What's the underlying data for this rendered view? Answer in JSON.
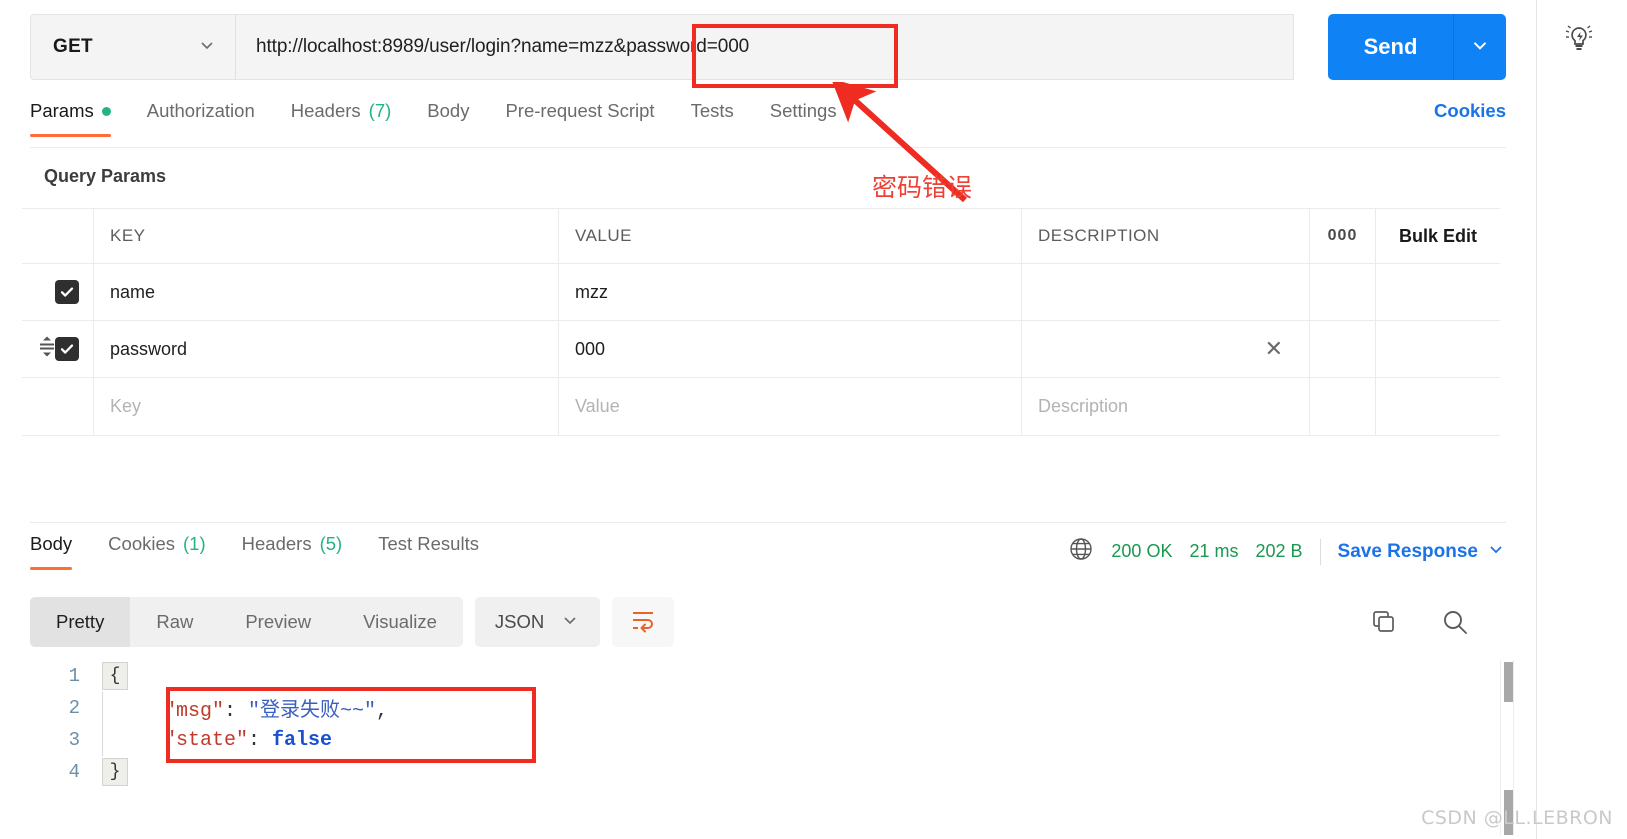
{
  "request": {
    "method": "GET",
    "url": "http://localhost:8989/user/login?name=mzz&password=000",
    "send_label": "Send",
    "tabs": [
      {
        "label": "Params",
        "badge": "",
        "dot": true,
        "active": true
      },
      {
        "label": "Authorization",
        "badge": "",
        "dot": false,
        "active": false
      },
      {
        "label": "Headers",
        "badge": "(7)",
        "dot": false,
        "active": false
      },
      {
        "label": "Body",
        "badge": "",
        "dot": false,
        "active": false
      },
      {
        "label": "Pre-request Script",
        "badge": "",
        "dot": false,
        "active": false
      },
      {
        "label": "Tests",
        "badge": "",
        "dot": false,
        "active": false
      },
      {
        "label": "Settings",
        "badge": "",
        "dot": false,
        "active": false
      }
    ],
    "cookies_link": "Cookies"
  },
  "params": {
    "section_title": "Query Params",
    "columns": {
      "key": "KEY",
      "value": "VALUE",
      "description": "DESCRIPTION"
    },
    "dots_label": "000",
    "bulk_edit_label": "Bulk Edit",
    "rows": [
      {
        "checked": true,
        "key": "name",
        "value": "mzz",
        "description": ""
      },
      {
        "checked": true,
        "key": "password",
        "value": "000",
        "description": ""
      }
    ],
    "placeholders": {
      "key": "Key",
      "value": "Value",
      "description": "Description"
    }
  },
  "response": {
    "tabs": [
      {
        "label": "Body",
        "badge": "",
        "active": true
      },
      {
        "label": "Cookies",
        "badge": "(1)",
        "active": false
      },
      {
        "label": "Headers",
        "badge": "(5)",
        "active": false
      },
      {
        "label": "Test Results",
        "badge": "",
        "active": false
      }
    ],
    "status": "200 OK",
    "time": "21 ms",
    "size": "202 B",
    "save_label": "Save Response",
    "view_modes": [
      {
        "label": "Pretty",
        "active": true
      },
      {
        "label": "Raw",
        "active": false
      },
      {
        "label": "Preview",
        "active": false
      },
      {
        "label": "Visualize",
        "active": false
      }
    ],
    "format": "JSON",
    "body_lines": [
      {
        "n": "1",
        "fold": "{",
        "text": ""
      },
      {
        "n": "2",
        "fold": "",
        "key": "\"msg\"",
        "sep": ": ",
        "value": "\"登录失败~~\"",
        "tail": ",",
        "vtype": "string"
      },
      {
        "n": "3",
        "fold": "",
        "key": "\"state\"",
        "sep": ": ",
        "value": "false",
        "tail": "",
        "vtype": "bool"
      },
      {
        "n": "4",
        "fold": "}",
        "text": ""
      }
    ]
  },
  "annotations": {
    "password_error": "密码错误"
  },
  "watermark": "CSDN @LL.LEBRON",
  "colors": {
    "accent_blue": "#0f83f5",
    "accent_orange": "#ff6c37",
    "status_green": "#1a9850",
    "annotation_red": "#ee2c21"
  }
}
